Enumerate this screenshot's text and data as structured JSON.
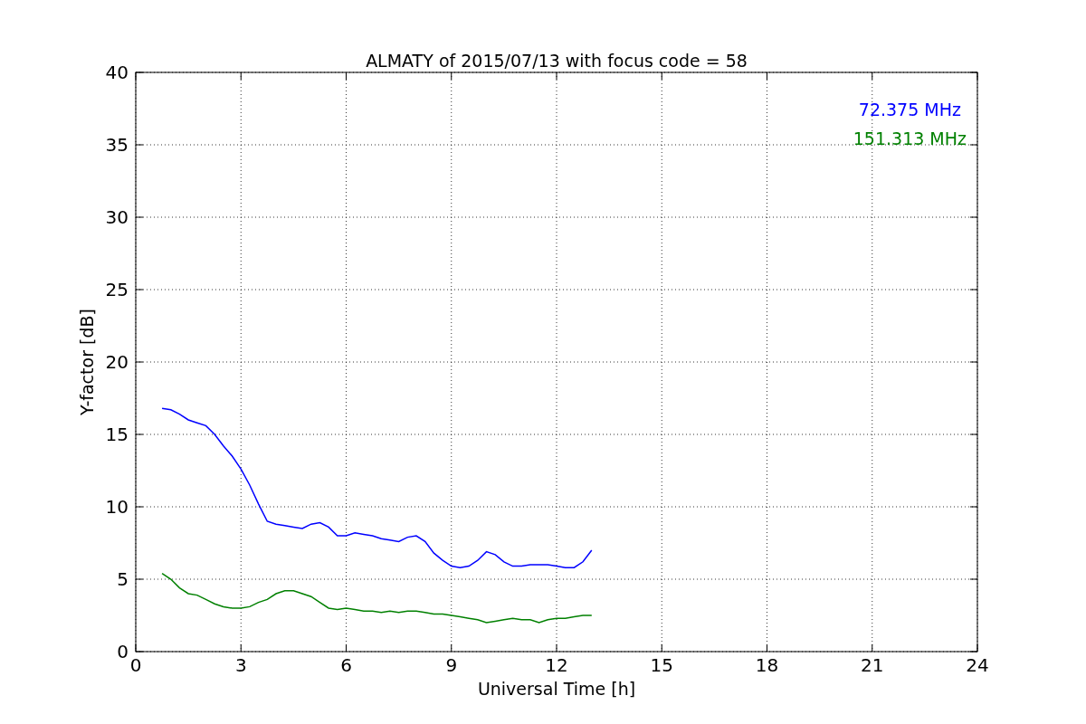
{
  "figure": {
    "chart_data": {
      "type": "line",
      "title": "ALMATY of 2015/07/13 with focus code = 58",
      "xlabel": "Universal Time [h]",
      "ylabel": "Y-factor [dB]",
      "x": [
        0.75,
        1,
        1.25,
        1.5,
        1.75,
        2,
        2.25,
        2.5,
        2.75,
        3,
        3.25,
        3.5,
        3.75,
        4,
        4.25,
        4.5,
        4.75,
        5,
        5.25,
        5.5,
        5.75,
        6,
        6.25,
        6.5,
        6.75,
        7,
        7.25,
        7.5,
        7.75,
        8,
        8.25,
        8.5,
        8.75,
        9,
        9.25,
        9.5,
        9.75,
        10,
        10.25,
        10.5,
        10.75,
        11,
        11.25,
        11.5,
        11.75,
        12,
        12.25,
        12.5,
        12.75,
        13
      ],
      "series": [
        {
          "name": "72.375 MHz",
          "color": "#0000ff",
          "values": [
            16.8,
            16.7,
            16.4,
            16.0,
            15.8,
            15.6,
            15.0,
            14.2,
            13.5,
            12.6,
            11.5,
            10.2,
            9.0,
            8.8,
            8.7,
            8.6,
            8.5,
            8.8,
            8.9,
            8.6,
            8.0,
            8.0,
            8.2,
            8.1,
            8.0,
            7.8,
            7.7,
            7.6,
            7.9,
            8.0,
            7.6,
            6.8,
            6.3,
            5.9,
            5.8,
            5.9,
            6.3,
            6.9,
            6.7,
            6.2,
            5.9,
            5.9,
            6.0,
            6.0,
            6.0,
            5.9,
            5.8,
            5.8,
            6.2,
            7.0
          ]
        },
        {
          "name": "151.313 MHz",
          "color": "#008000",
          "values": [
            5.4,
            5.0,
            4.4,
            4.0,
            3.9,
            3.6,
            3.3,
            3.1,
            3.0,
            3.0,
            3.1,
            3.4,
            3.6,
            4.0,
            4.2,
            4.2,
            4.0,
            3.8,
            3.4,
            3.0,
            2.9,
            3.0,
            2.9,
            2.8,
            2.8,
            2.7,
            2.8,
            2.7,
            2.8,
            2.8,
            2.7,
            2.6,
            2.6,
            2.5,
            2.4,
            2.3,
            2.2,
            2.0,
            2.1,
            2.2,
            2.3,
            2.2,
            2.2,
            2.0,
            2.2,
            2.3,
            2.3,
            2.4,
            2.5,
            2.5
          ]
        }
      ],
      "grid": true,
      "xlim": [
        0,
        24
      ],
      "ylim": [
        0,
        40
      ],
      "xticks": [
        0,
        3,
        6,
        9,
        12,
        15,
        18,
        21,
        24
      ],
      "yticks": [
        0,
        5,
        10,
        15,
        20,
        25,
        30,
        35,
        40
      ]
    }
  }
}
